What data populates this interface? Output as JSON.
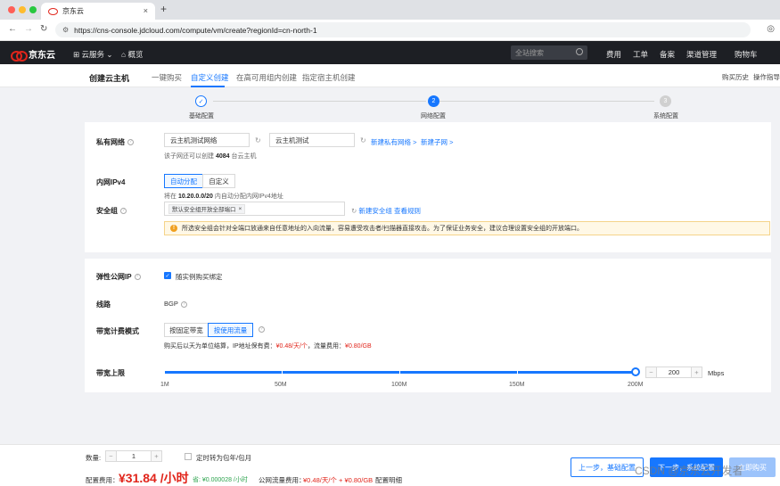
{
  "browser": {
    "tab_title": "京东云",
    "tab_close": "×",
    "new_tab": "+",
    "url": "https://cns-console.jdcloud.com/compute/vm/create?regionId=cn-north-1"
  },
  "topnav": {
    "brand": "京东云",
    "cloud_services": "云服务",
    "overview": "概览",
    "search_placeholder": "全站搜索",
    "items": [
      "费用",
      "工单",
      "备案",
      "渠道管理",
      "购物车"
    ]
  },
  "subheader": {
    "title": "创建云主机",
    "tabs": [
      "一键购买",
      "自定义创建",
      "在高可用组内创建",
      "指定宿主机创建"
    ],
    "active_tab": 1,
    "history": "购买历史",
    "guide": "操作指导"
  },
  "steps": [
    {
      "number": "",
      "label": "基础配置",
      "state": "done"
    },
    {
      "number": "2",
      "label": "网络配置",
      "state": "active"
    },
    {
      "number": "3",
      "label": "系统配置",
      "state": "pending"
    }
  ],
  "network": {
    "label": "私有网络",
    "vpc_value": "云主机测试网络",
    "subnet_value": "云主机测试",
    "new_vpc_link": "新建私有网络 >",
    "new_subnet_link": "新建子网 >",
    "hint_prefix": "该子网还可以创建",
    "hint_count": "4084",
    "hint_suffix": "台云主机"
  },
  "ipv4": {
    "label": "内网IPv4",
    "options": [
      "自动分配",
      "自定义"
    ],
    "hint_prefix": "将在",
    "hint_cidr": "10.20.0.0/20",
    "hint_suffix": "内自动分配内网IPv4地址"
  },
  "security_group": {
    "label": "安全组",
    "tag": "默认安全组开放全部端口",
    "tag_close": "×",
    "new_link": "新建安全组",
    "view_link": "查看规则",
    "warning": "所选安全组会针对全端口放通来自任意地址的入向流量，容易遭受攻击者/扫描器直接攻击。为了保证业务安全，建议合理设置安全组的开放端口。"
  },
  "eip": {
    "label": "弹性公网IP",
    "checkbox_label": "随实例购买绑定"
  },
  "line": {
    "label": "线路",
    "value": "BGP"
  },
  "billing": {
    "label": "带宽计费模式",
    "options": [
      "按固定带宽",
      "按使用流量"
    ],
    "hint_prefix": "购买后以天为单位结算，IP地址保有费：",
    "ip_fee": "¥0.48/天/个",
    "traffic_prefix": "，流量费用：",
    "traffic_fee": "¥0.80/GB"
  },
  "bandwidth": {
    "label": "带宽上限",
    "value": "200",
    "unit": "Mbps",
    "minus": "−",
    "plus": "+",
    "ticks": [
      "1M",
      "50M",
      "100M",
      "150M",
      "200M"
    ],
    "level_percent": 100
  },
  "bottom": {
    "qty_label": "数量:",
    "qty_value": "1",
    "minus": "−",
    "plus": "+",
    "renew_label": "定时转为包年/包月",
    "fee_label": "配置费用：",
    "fee_value": "¥31.84 /小时",
    "saved": "省: ¥0.000028 /小时",
    "traffic_label": "公网流量费用：",
    "traffic_value": "¥0.48/天/个 + ¥0.80/GB",
    "detail_link": "配置明细",
    "prev_button": "上一步，基础配置",
    "next_button": "下一步，系统配置",
    "buy_button": "立即购买",
    "watermark": "CSDN @京东云开发者"
  },
  "colors": {
    "accent": "#1677ff",
    "price": "#e1251b",
    "nav_bg": "#1d1f24"
  }
}
